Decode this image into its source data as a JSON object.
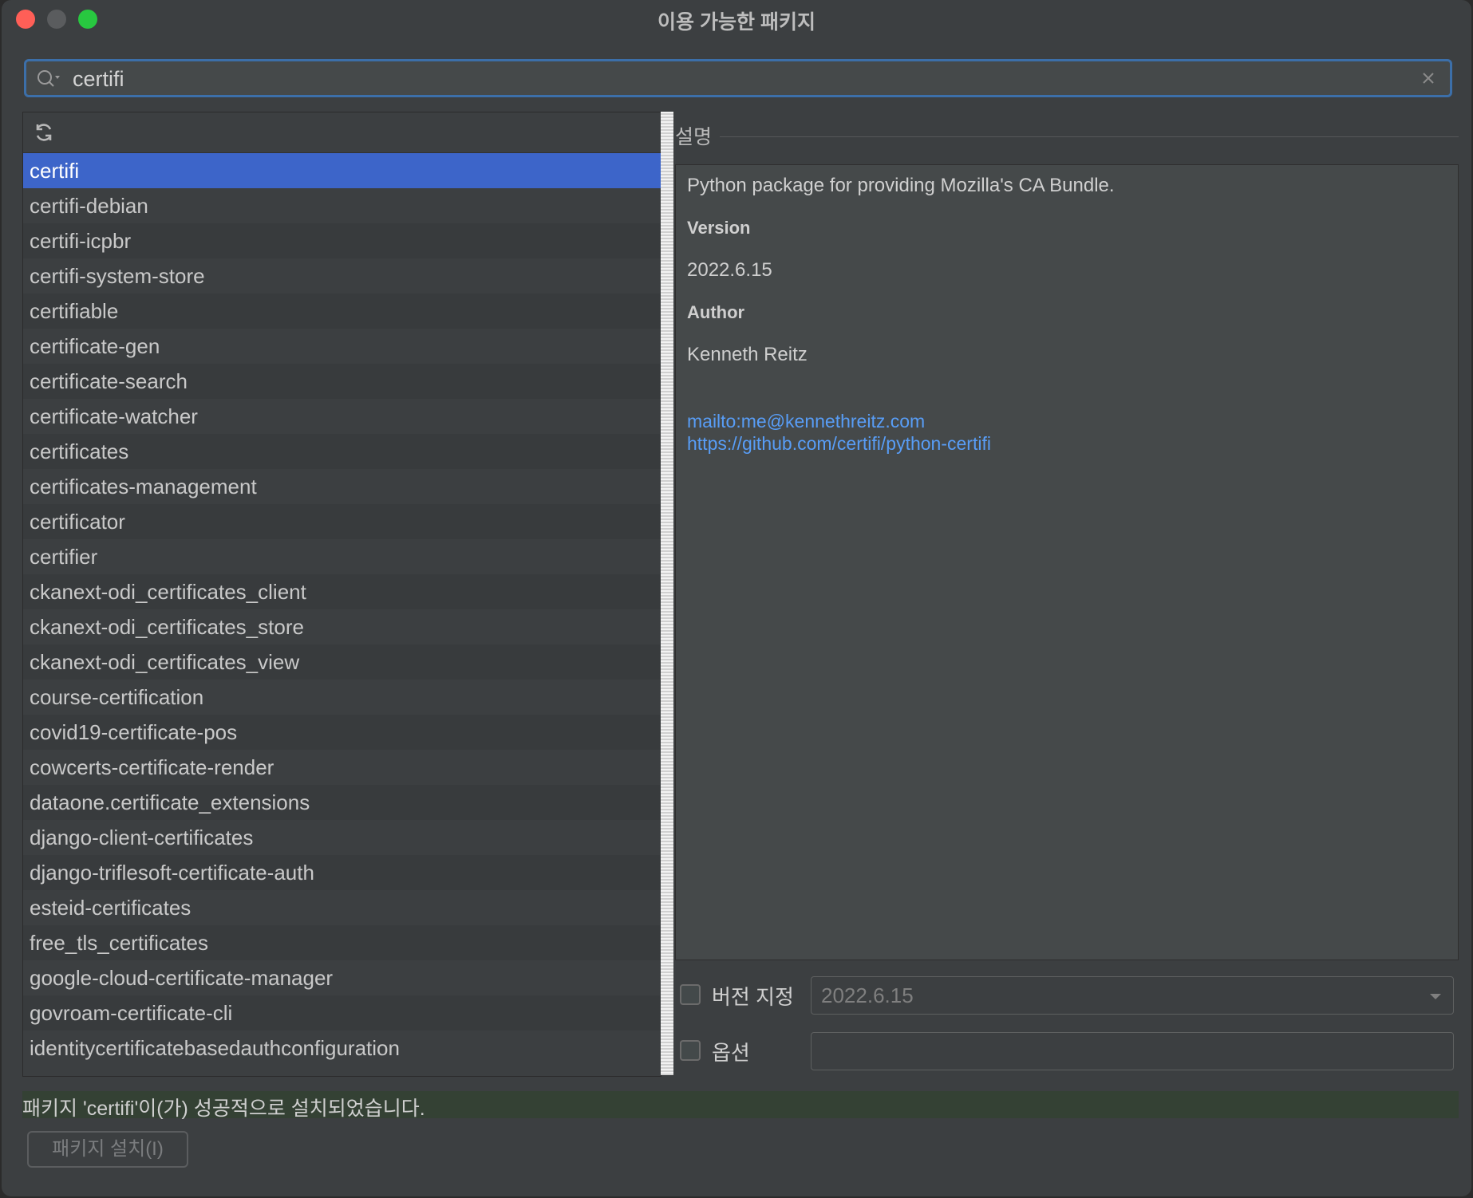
{
  "window": {
    "title": "이용 가능한 패키지"
  },
  "search": {
    "value": "certifi"
  },
  "packages": [
    "certifi",
    "certifi-debian",
    "certifi-icpbr",
    "certifi-system-store",
    "certifiable",
    "certificate-gen",
    "certificate-search",
    "certificate-watcher",
    "certificates",
    "certificates-management",
    "certificator",
    "certifier",
    "ckanext-odi_certificates_client",
    "ckanext-odi_certificates_store",
    "ckanext-odi_certificates_view",
    "course-certification",
    "covid19-certificate-pos",
    "cowcerts-certificate-render",
    "dataone.certificate_extensions",
    "django-client-certificates",
    "django-triflesoft-certificate-auth",
    "esteid-certificates",
    "free_tls_certificates",
    "google-cloud-certificate-manager",
    "govroam-certificate-cli",
    "identitycertificatebasedauthconfiguration"
  ],
  "selected_package": "certifi",
  "description": {
    "header": "설명",
    "summary": "Python package for providing Mozilla's CA Bundle.",
    "version_label": "Version",
    "version": "2022.6.15",
    "author_label": "Author",
    "author": "Kenneth Reitz",
    "email_link": "mailto:me@kennethreitz.com",
    "homepage_link": "https://github.com/certifi/python-certifi"
  },
  "options": {
    "specify_version_label": "버전 지정",
    "specify_version_checked": false,
    "version_value": "2022.6.15",
    "options_label": "옵션",
    "options_checked": false,
    "options_value": ""
  },
  "status": {
    "message": "패키지 'certifi'이(가) 성공적으로 설치되었습니다."
  },
  "buttons": {
    "install": "패키지 설치(I)"
  },
  "colors": {
    "selection": "#3d65c9",
    "link": "#589df6",
    "status_bg": "#344134",
    "focus_border": "#3c6fa9"
  }
}
